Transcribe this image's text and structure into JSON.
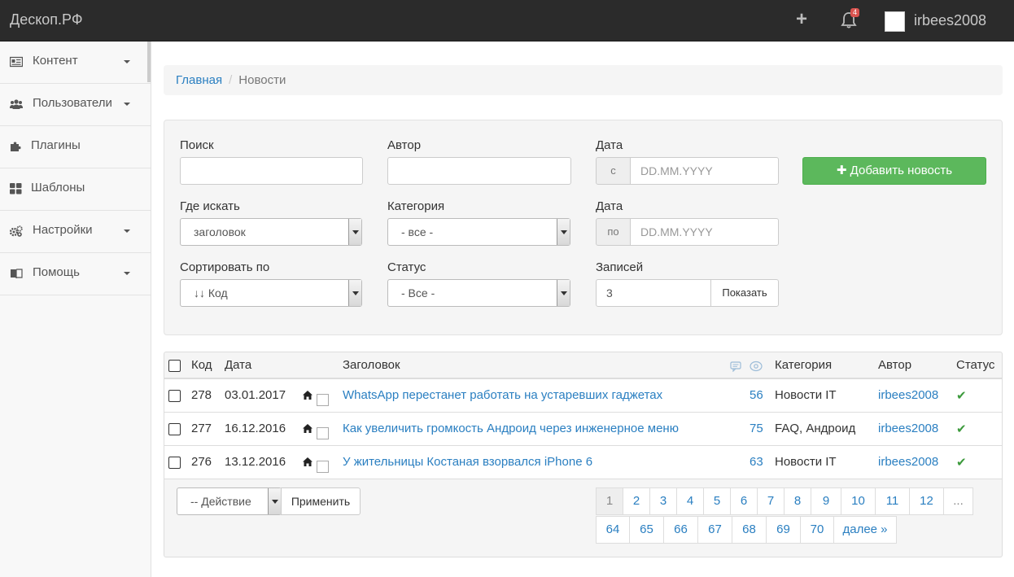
{
  "navbar": {
    "brand": "Дескоп.РФ",
    "plus_label": "+",
    "notifications_count": "4",
    "username": "irbees2008"
  },
  "sidebar": {
    "items": [
      {
        "label": "Контент",
        "icon": "newspaper-icon",
        "has_caret": true
      },
      {
        "label": "Пользователи",
        "icon": "users-icon",
        "has_caret": true
      },
      {
        "label": "Плагины",
        "icon": "puzzle-icon",
        "has_caret": false
      },
      {
        "label": "Шаблоны",
        "icon": "th-large-icon",
        "has_caret": false
      },
      {
        "label": "Настройки",
        "icon": "gears-icon",
        "has_caret": true
      },
      {
        "label": "Помощь",
        "icon": "book-icon",
        "has_caret": true
      }
    ]
  },
  "breadcrumb": {
    "home": "Главная",
    "current": "Новости"
  },
  "filter": {
    "search_label": "Поиск",
    "search_value": "",
    "author_label": "Автор",
    "author_value": "",
    "date_from_label": "Дата",
    "date_from_addon": "с",
    "date_from_placeholder": "DD.MM.YYYY",
    "date_to_label": "Дата",
    "date_to_addon": "по",
    "date_to_placeholder": "DD.MM.YYYY",
    "where_label": "Где искать",
    "where_value": "заголовок",
    "category_label": "Категория",
    "category_value": "- все -",
    "sort_label": "Сортировать по",
    "sort_value": "↓↓ Код",
    "status_label": "Статус",
    "status_value": "- Все -",
    "records_label": "Записей",
    "records_value": "3",
    "show_button": "Показать",
    "add_button": "✚ Добавить новость"
  },
  "table": {
    "headers": {
      "id": "Код",
      "date": "Дата",
      "title": "Заголовок",
      "category": "Категория",
      "author": "Автор",
      "status": "Статус"
    },
    "rows": [
      {
        "id": "278",
        "date": "03.01.2017",
        "title": "WhatsApp перестанет работать на устаревших гаджетах",
        "views": "56",
        "category": "Новости IT",
        "author": "irbees2008",
        "status": "✔"
      },
      {
        "id": "277",
        "date": "16.12.2016",
        "title": "Как увеличить громкость Андроид через инженерное меню",
        "views": "75",
        "category": "FAQ, Андроид",
        "author": "irbees2008",
        "status": "✔"
      },
      {
        "id": "276",
        "date": "13.12.2016",
        "title": "У жительницы Костаная взорвался iPhone 6",
        "views": "63",
        "category": "Новости IT",
        "author": "irbees2008",
        "status": "✔"
      }
    ]
  },
  "actions": {
    "select_value": "-- Действие",
    "apply_button": "Применить"
  },
  "pagination": {
    "row1": [
      "1",
      "2",
      "3",
      "4",
      "5",
      "6",
      "7",
      "8",
      "9",
      "10",
      "11",
      "12",
      "..."
    ],
    "row2": [
      "64",
      "65",
      "66",
      "67",
      "68",
      "69",
      "70",
      "далее »"
    ],
    "active": "1"
  },
  "colors": {
    "navbar_bg": "#2b2b2b",
    "link": "#2a7fc1",
    "success": "#5cb85c",
    "badge": "#d9534f"
  }
}
